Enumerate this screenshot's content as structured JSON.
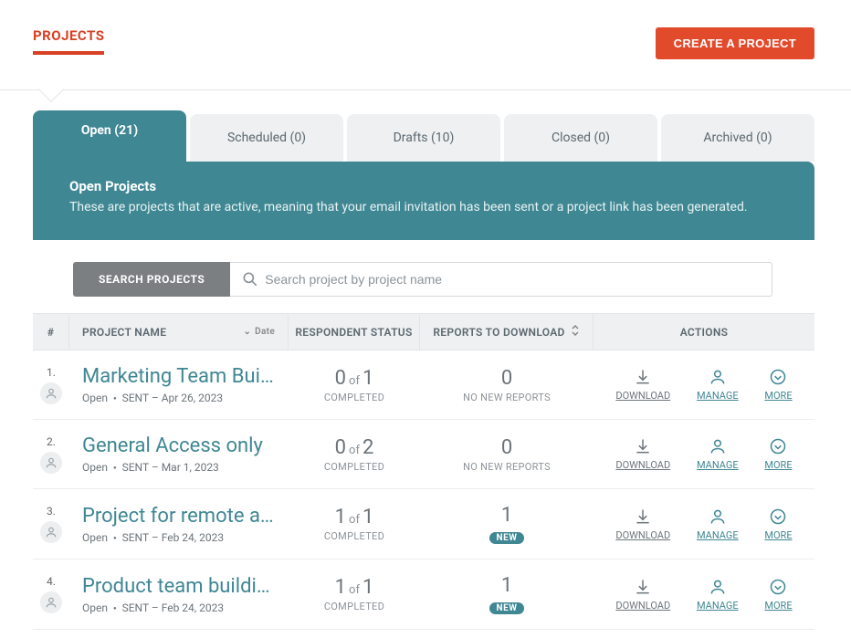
{
  "nav": {
    "projects_label": "PROJECTS"
  },
  "create_button": "CREATE A PROJECT",
  "tabs": [
    {
      "label": "Open (21)",
      "active": true
    },
    {
      "label": "Scheduled (0)",
      "active": false
    },
    {
      "label": "Drafts (10)",
      "active": false
    },
    {
      "label": "Closed (0)",
      "active": false
    },
    {
      "label": "Archived (0)",
      "active": false
    }
  ],
  "banner": {
    "title": "Open Projects",
    "desc": "These are projects that are active, meaning that your email invitation has been sent or a project link has been generated."
  },
  "search": {
    "button_label": "SEARCH PROJECTS",
    "placeholder": "Search project by project name"
  },
  "columns": {
    "num": "#",
    "name": "PROJECT NAME",
    "date": "Date",
    "respondent": "RESPONDENT STATUS",
    "reports": "REPORTS TO DOWNLOAD",
    "actions": "ACTIONS"
  },
  "labels": {
    "of": "of",
    "completed": "COMPLETED",
    "no_new_reports": "NO NEW REPORTS",
    "new_badge": "NEW",
    "download": "DOWNLOAD",
    "manage": "MANAGE",
    "more": "MORE"
  },
  "projects": [
    {
      "num": "1.",
      "title": "Marketing Team Building",
      "status": "Open",
      "sent": "SENT – Apr 26, 2023",
      "done": "0",
      "total": "1",
      "reports": "0",
      "has_new": false
    },
    {
      "num": "2.",
      "title": "General Access only",
      "status": "Open",
      "sent": "SENT – Mar 1, 2023",
      "done": "0",
      "total": "2",
      "reports": "0",
      "has_new": false
    },
    {
      "num": "3.",
      "title": "Project for remote acce…",
      "status": "Open",
      "sent": "SENT – Feb 24, 2023",
      "done": "1",
      "total": "1",
      "reports": "1",
      "has_new": true
    },
    {
      "num": "4.",
      "title": "Product team building",
      "status": "Open",
      "sent": "SENT – Feb 24, 2023",
      "done": "1",
      "total": "1",
      "reports": "1",
      "has_new": true
    }
  ]
}
